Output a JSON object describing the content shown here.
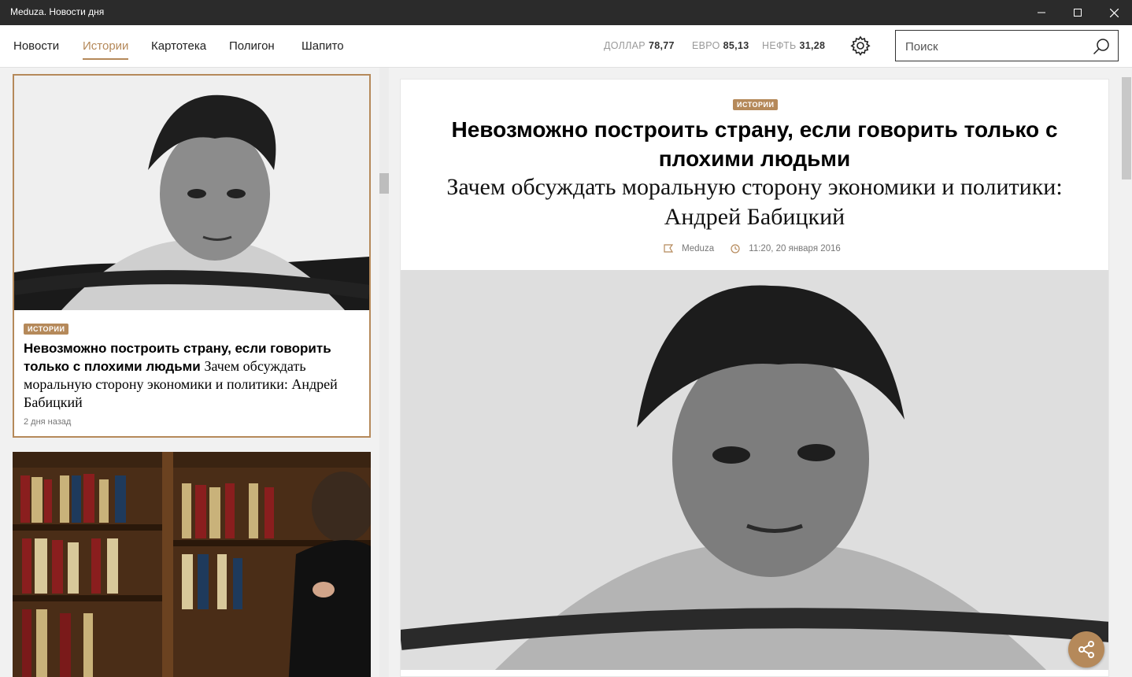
{
  "window": {
    "title": "Meduza. Новости дня"
  },
  "nav": {
    "items": [
      {
        "label": "Новости"
      },
      {
        "label": "Истории"
      },
      {
        "label": "Картотека"
      },
      {
        "label": "Полигон"
      },
      {
        "label": "Шапито"
      }
    ],
    "active_index": 1
  },
  "rates": [
    {
      "label": "ДОЛЛАР",
      "value": "78,77"
    },
    {
      "label": "ЕВРО",
      "value": "85,13"
    },
    {
      "label": "НЕФТЬ",
      "value": "31,28"
    }
  ],
  "search": {
    "placeholder": "Поиск"
  },
  "list": {
    "cards": [
      {
        "badge": "ИСТОРИИ",
        "title": "Невозможно построить страну, если говорить только с плохими людьми",
        "subtitle": "Зачем обсуждать моральную сторону экономики и политики: Андрей Бабицкий",
        "time": "2 дня назад"
      }
    ]
  },
  "article": {
    "badge": "ИСТОРИИ",
    "title": "Невозможно построить страну, если говорить только с плохими людьми",
    "subtitle": "Зачем обсуждать моральную сторону экономики и политики: Андрей Бабицкий",
    "source": "Meduza",
    "datetime": "11:20, 20 января 2016"
  },
  "colors": {
    "accent": "#b5895a",
    "titlebar": "#2b2b2b"
  }
}
